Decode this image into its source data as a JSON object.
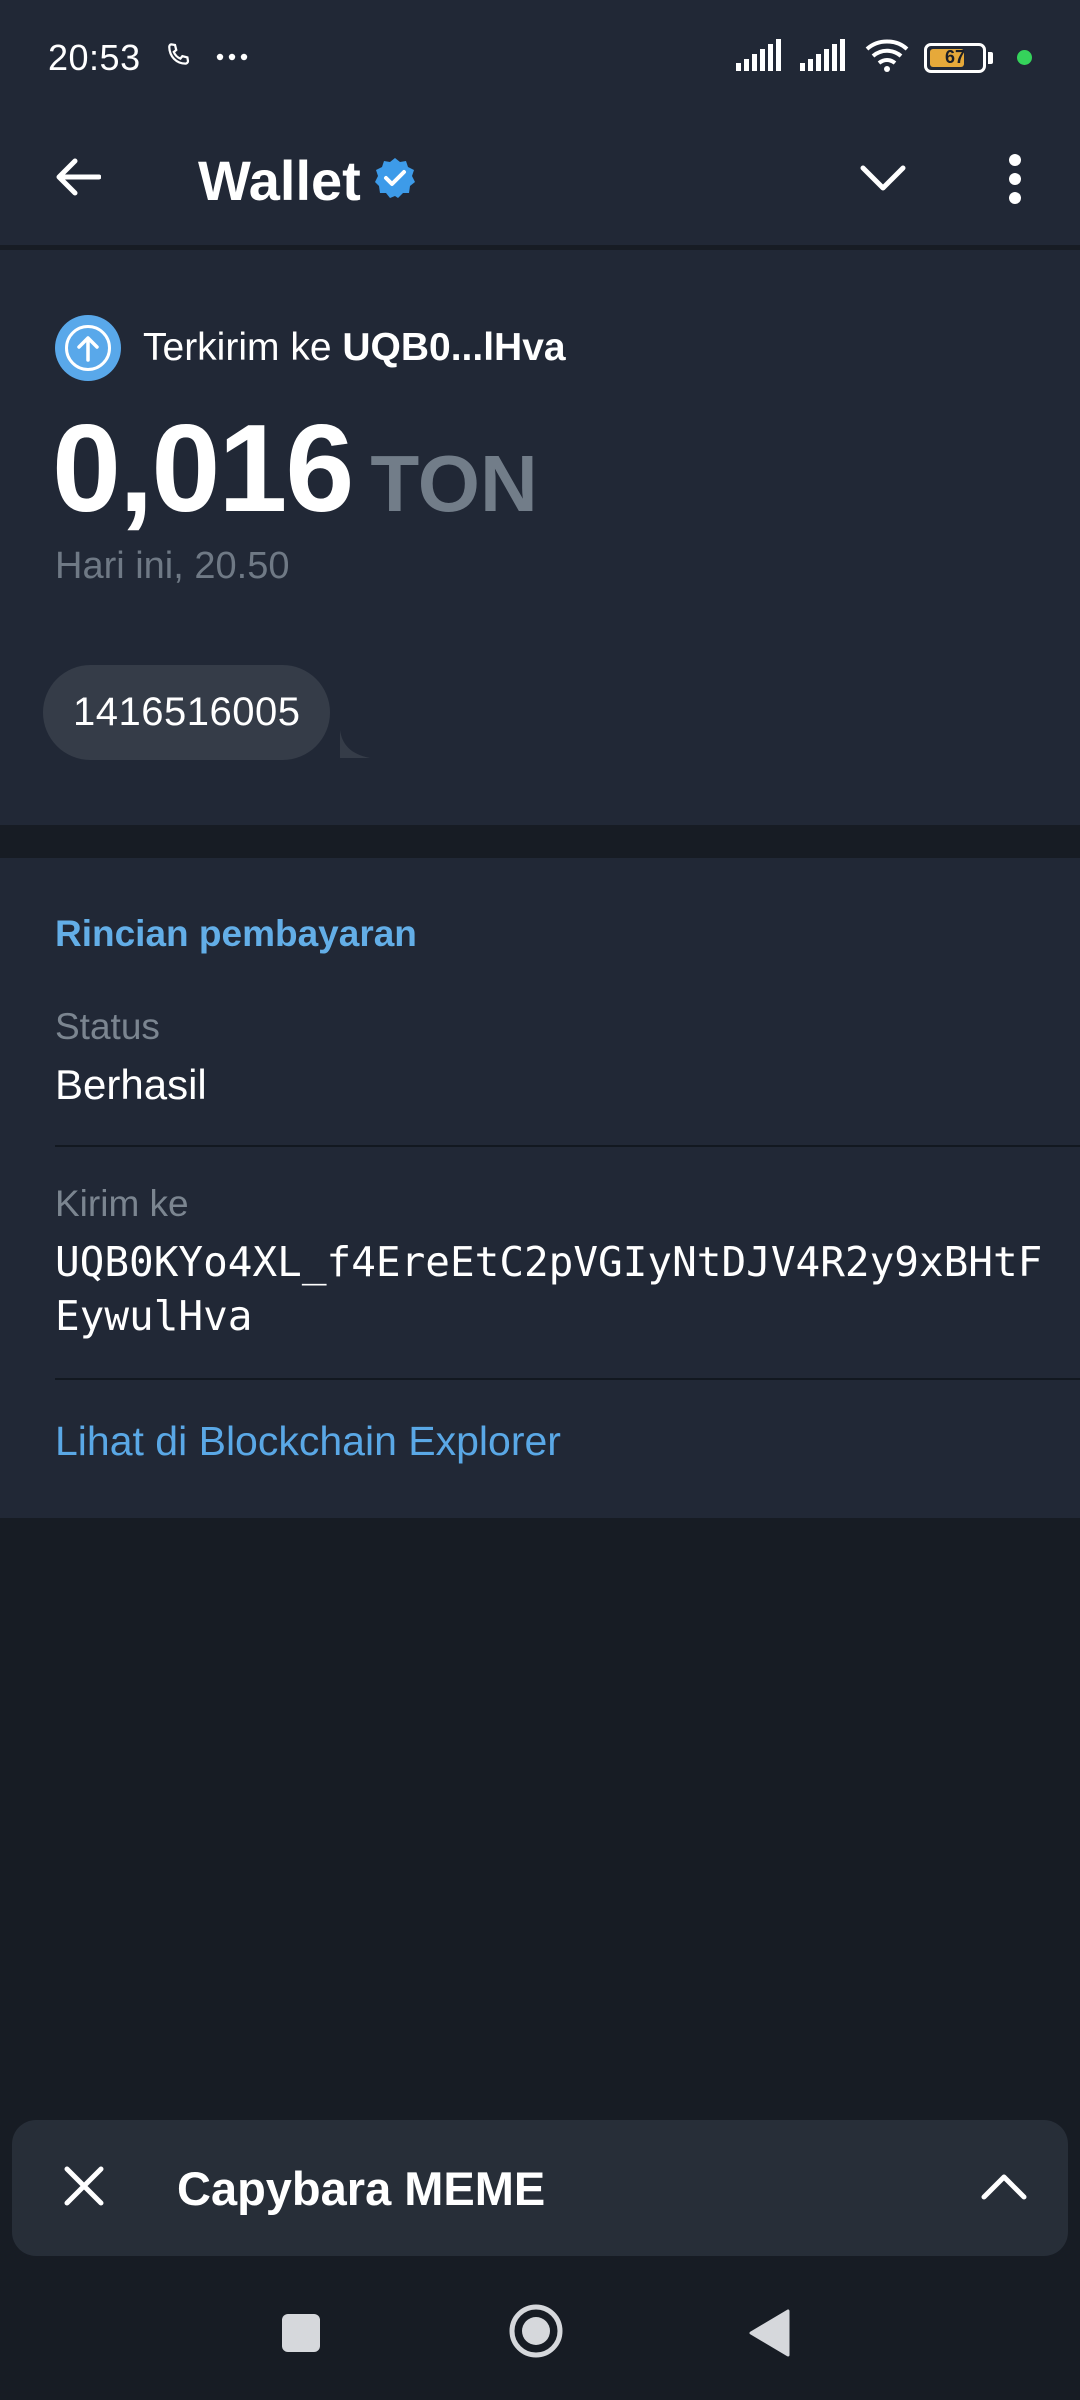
{
  "status_bar": {
    "time": "20:53",
    "battery_level": "67",
    "battery_fraction": 0.67,
    "icons": [
      "phone-icon",
      "more-dots-icon",
      "signal-icon",
      "signal-icon",
      "wifi-icon",
      "battery-icon"
    ]
  },
  "header": {
    "title": "Wallet",
    "icons": [
      "back-arrow-icon",
      "verified-badge-icon",
      "chevron-down-icon",
      "more-vertical-icon"
    ]
  },
  "transaction": {
    "label": "Terkirim ke",
    "address_short": "UQB0...lHva",
    "amount": "0,016",
    "currency": "TON",
    "date": "Hari ini, 20.50",
    "comment": "1416516005",
    "icon": "arrow-up-icon"
  },
  "details": {
    "title": "Rincian pembayaran",
    "status_label": "Status",
    "status_value": "Berhasil",
    "recipient_label": "Kirim ke",
    "recipient_address": "UQB0KYo4XL_f4EreEtC2pVGIyNtDJV4R2y9xBHtFEywulHva",
    "explorer_link": "Lihat di Blockchain Explorer"
  },
  "mini_app_bar": {
    "title": "Capybara MEME",
    "icons": [
      "close-icon",
      "chevron-up-icon"
    ]
  },
  "nav_bar": {
    "icons": [
      "recents-icon",
      "home-icon",
      "back-icon"
    ]
  },
  "colors": {
    "background": "#171c24",
    "card": "#212836",
    "accent_blue": "#63aee7",
    "muted_text": "#727d89",
    "battery_fill": "#e6a93a",
    "status_dot": "#35d35b"
  }
}
